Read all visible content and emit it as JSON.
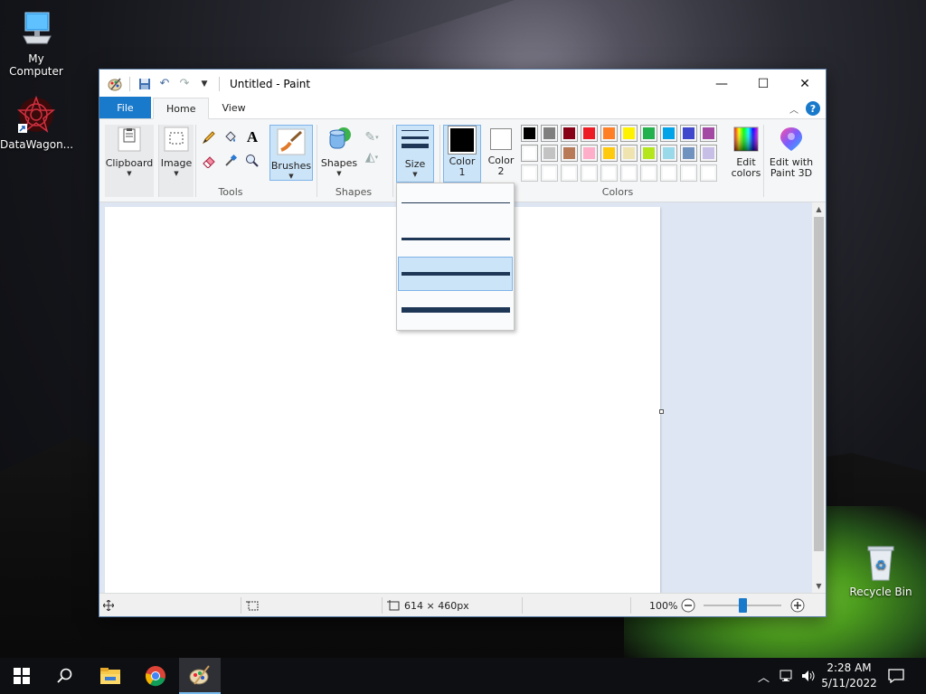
{
  "desktop": {
    "icons": [
      {
        "label": "My Computer"
      },
      {
        "label": "DataWagon..."
      },
      {
        "label": "Recycle Bin"
      }
    ]
  },
  "window": {
    "title": "Untitled - Paint",
    "controls": {
      "minimize": "—",
      "maximize": "☐",
      "close": "✕"
    }
  },
  "tabs": {
    "file": "File",
    "home": "Home",
    "view": "View",
    "help": "?"
  },
  "ribbon": {
    "clipboard": {
      "label": "Clipboard"
    },
    "image": {
      "label": "Image"
    },
    "tools": {
      "label": "Tools"
    },
    "brushes": {
      "label": "Brushes"
    },
    "shapes": {
      "label": "Shapes",
      "group_label": "Shapes"
    },
    "size": {
      "label": "Size"
    },
    "color1": {
      "label1": "Color",
      "label2": "1",
      "value": "#000000"
    },
    "color2": {
      "label1": "Color",
      "label2": "2",
      "value": "#ffffff"
    },
    "colors_group": {
      "label": "Colors"
    },
    "edit_colors": {
      "label1": "Edit",
      "label2": "colors"
    },
    "edit_paint3d": {
      "label1": "Edit with",
      "label2": "Paint 3D"
    }
  },
  "palette": {
    "row1": [
      "#000000",
      "#7f7f7f",
      "#880015",
      "#ed1c24",
      "#ff7f27",
      "#fff200",
      "#22b14c",
      "#00a2e8",
      "#3f48cc",
      "#a349a4"
    ],
    "row2": [
      "#ffffff",
      "#c3c3c3",
      "#b97a57",
      "#ffaec9",
      "#ffc90e",
      "#efe4b0",
      "#b5e61d",
      "#99d9ea",
      "#7092be",
      "#c8bfe7"
    ],
    "row3": [
      "#ffffff",
      "#ffffff",
      "#ffffff",
      "#ffffff",
      "#ffffff",
      "#ffffff",
      "#ffffff",
      "#ffffff",
      "#ffffff",
      "#ffffff"
    ]
  },
  "size_dropdown": {
    "options": [
      {
        "name": "1px"
      },
      {
        "name": "3px"
      },
      {
        "name": "5px",
        "selected": true
      },
      {
        "name": "8px"
      }
    ]
  },
  "status": {
    "image_size": "614 × 460px",
    "zoom": "100%",
    "zoom_level_fraction": 0.5
  },
  "taskbar": {
    "time": "2:28 AM",
    "date": "5/11/2022"
  }
}
